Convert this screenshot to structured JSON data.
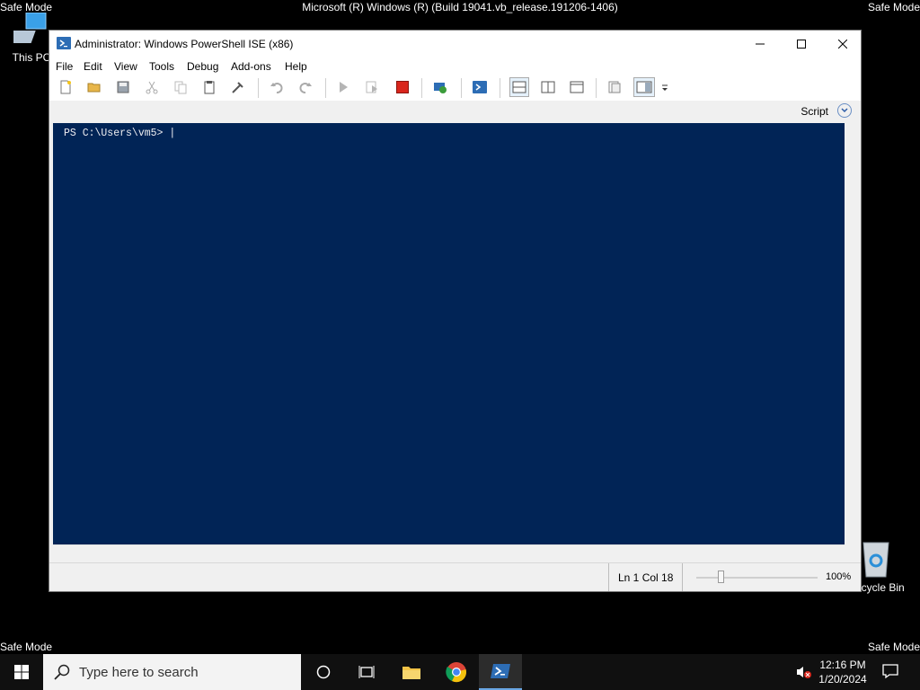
{
  "desktop": {
    "watermark": "Safe Mode",
    "build": "Microsoft (R) Windows (R) (Build 19041.vb_release.191206-1406)",
    "this_pc": "This PC",
    "recycle_bin": "Recycle Bin"
  },
  "window": {
    "title": "Administrator: Windows PowerShell ISE (x86)",
    "menu": [
      "File",
      "Edit",
      "View",
      "Tools",
      "Debug",
      "Add-ons",
      "Help"
    ],
    "script_label": "Script",
    "prompt": "PS C:\\Users\\vm5> |",
    "status": {
      "position": "Ln 1  Col 18",
      "zoom": "100%",
      "zoom_fraction": 0.2
    }
  },
  "taskbar": {
    "search_placeholder": "Type here to search",
    "time": "12:16 PM",
    "date": "1/20/2024"
  },
  "icons": {
    "new": "new-script-icon",
    "open": "open-icon",
    "save": "save-icon",
    "cut": "cut-icon",
    "copy": "copy-icon",
    "paste": "paste-icon",
    "clear": "clear-console-icon",
    "undo": "undo-icon",
    "redo": "redo-icon",
    "run": "run-script-icon",
    "run_selection": "run-selection-icon",
    "stop": "stop-icon",
    "remote": "new-remote-tab-icon",
    "ps_console": "start-powershell-icon",
    "layout_top": "show-script-top-icon",
    "layout_right": "show-script-right-icon",
    "layout_max": "show-script-maximized-icon",
    "commands": "show-command-window-icon",
    "addon": "show-addon-pane-icon"
  },
  "colors": {
    "console_bg": "#012456",
    "taskbar": "#101010",
    "stop": "#d9261c"
  }
}
